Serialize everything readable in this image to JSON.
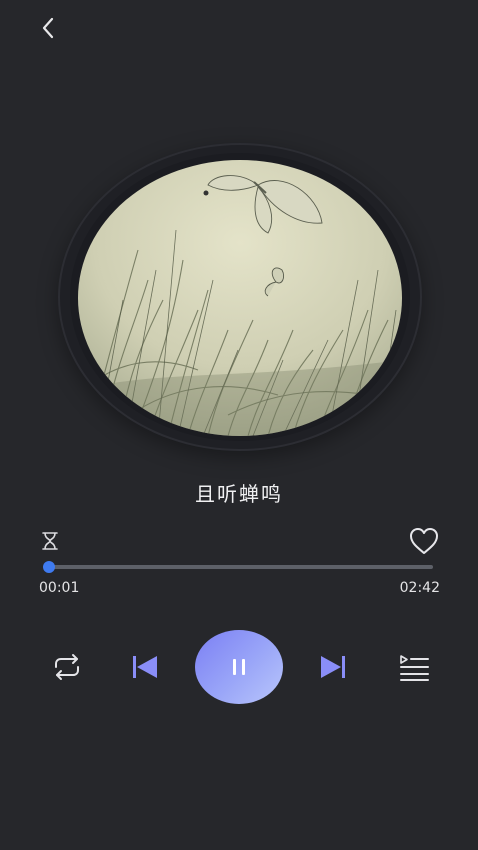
{
  "header": {
    "back_icon": "chevron-left-icon"
  },
  "song": {
    "title": "且听蝉鸣"
  },
  "progress": {
    "current": "00:01",
    "total": "02:42",
    "fraction": 0.006
  },
  "controls": {
    "loop_icon": "repeat-icon",
    "prev_icon": "skip-previous-icon",
    "play_pause_icon": "pause-icon",
    "next_icon": "skip-next-icon",
    "playlist_icon": "playlist-icon",
    "timer_icon": "hourglass-icon",
    "favorite_icon": "heart-icon"
  },
  "colors": {
    "background": "#26272b",
    "accent": "#3f7bf0",
    "play_gradient_start": "#7b7ff4",
    "play_gradient_end": "#b9c6fb",
    "skip_icon": "#8a8ef8"
  }
}
